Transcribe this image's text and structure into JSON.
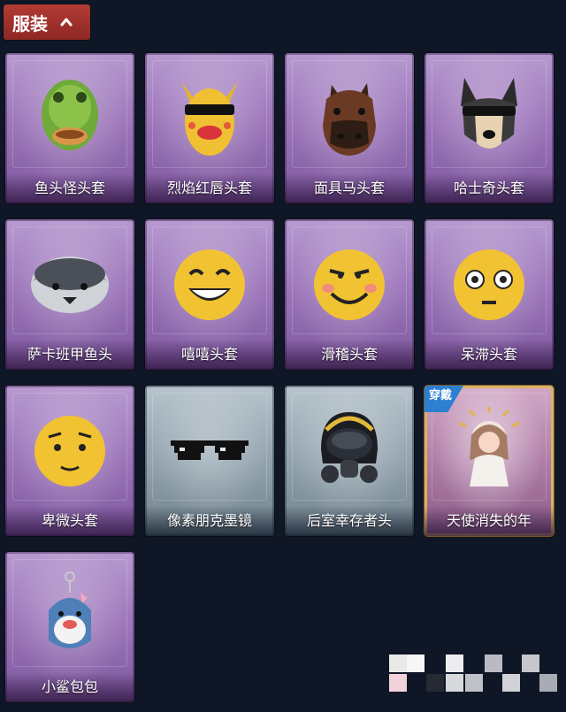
{
  "tab": {
    "label": "服装"
  },
  "items": [
    {
      "name": "鱼头怪头套",
      "art": "fish-mask"
    },
    {
      "name": "烈焰红唇头套",
      "art": "lips-mask"
    },
    {
      "name": "面具马头套",
      "art": "horse-mask"
    },
    {
      "name": "哈士奇头套",
      "art": "husky-mask"
    },
    {
      "name": "萨卡班甲鱼头",
      "art": "sacabambaspis-mask"
    },
    {
      "name": "嘻嘻头套",
      "art": "grin-emoji-mask"
    },
    {
      "name": "滑稽头套",
      "art": "funny-emoji-mask"
    },
    {
      "name": "呆滞头套",
      "art": "dazed-emoji-mask"
    },
    {
      "name": "卑微头套",
      "art": "humble-emoji-mask"
    },
    {
      "name": "像素朋克墨镜",
      "art": "pixel-sunglasses"
    },
    {
      "name": "后室幸存者头",
      "art": "gas-mask-helmet"
    },
    {
      "name": "天使消失的年",
      "art": "angel-doll-charm",
      "badge": "穿戴"
    },
    {
      "name": "小鲨包包",
      "art": "shark-bag-charm"
    }
  ],
  "colors": {
    "background": "#0f1626",
    "tab": "#a3302b",
    "card_purple": "#9e78bb",
    "card_blue": "#93a4af",
    "equipped_border": "#d8b264",
    "equipped_badge": "#2d7fd1"
  }
}
